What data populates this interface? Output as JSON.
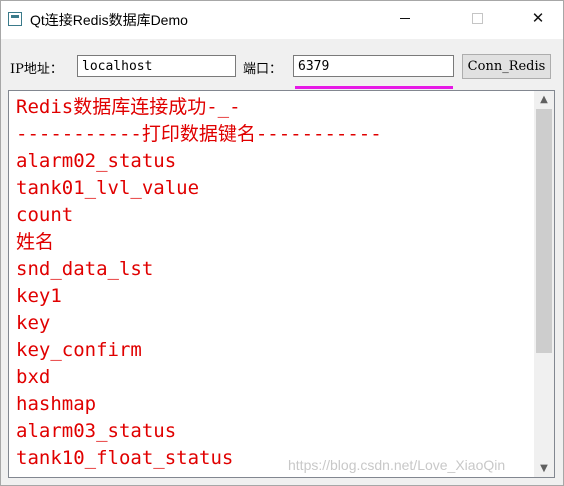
{
  "window": {
    "title": "Qt连接Redis数据库Demo"
  },
  "form": {
    "ip_label": "IP地址：",
    "ip_value": "localhost",
    "port_label": "端口：",
    "port_value": "6379",
    "connect_button": "Conn_Redis"
  },
  "log": {
    "lines": [
      "Redis数据库连接成功-_-",
      "-----------打印数据键名-----------",
      "alarm02_status",
      "tank01_lvl_value",
      "count",
      "姓名",
      "snd_data_lst",
      "key1",
      "key",
      "key_confirm",
      "bxd",
      "hashmap",
      "alarm03_status",
      "tank10_float_status"
    ],
    "text_color": "#e00000"
  },
  "highlight_color": "#e619e6",
  "watermark": "https://blog.csdn.net/Love_XiaoQin"
}
